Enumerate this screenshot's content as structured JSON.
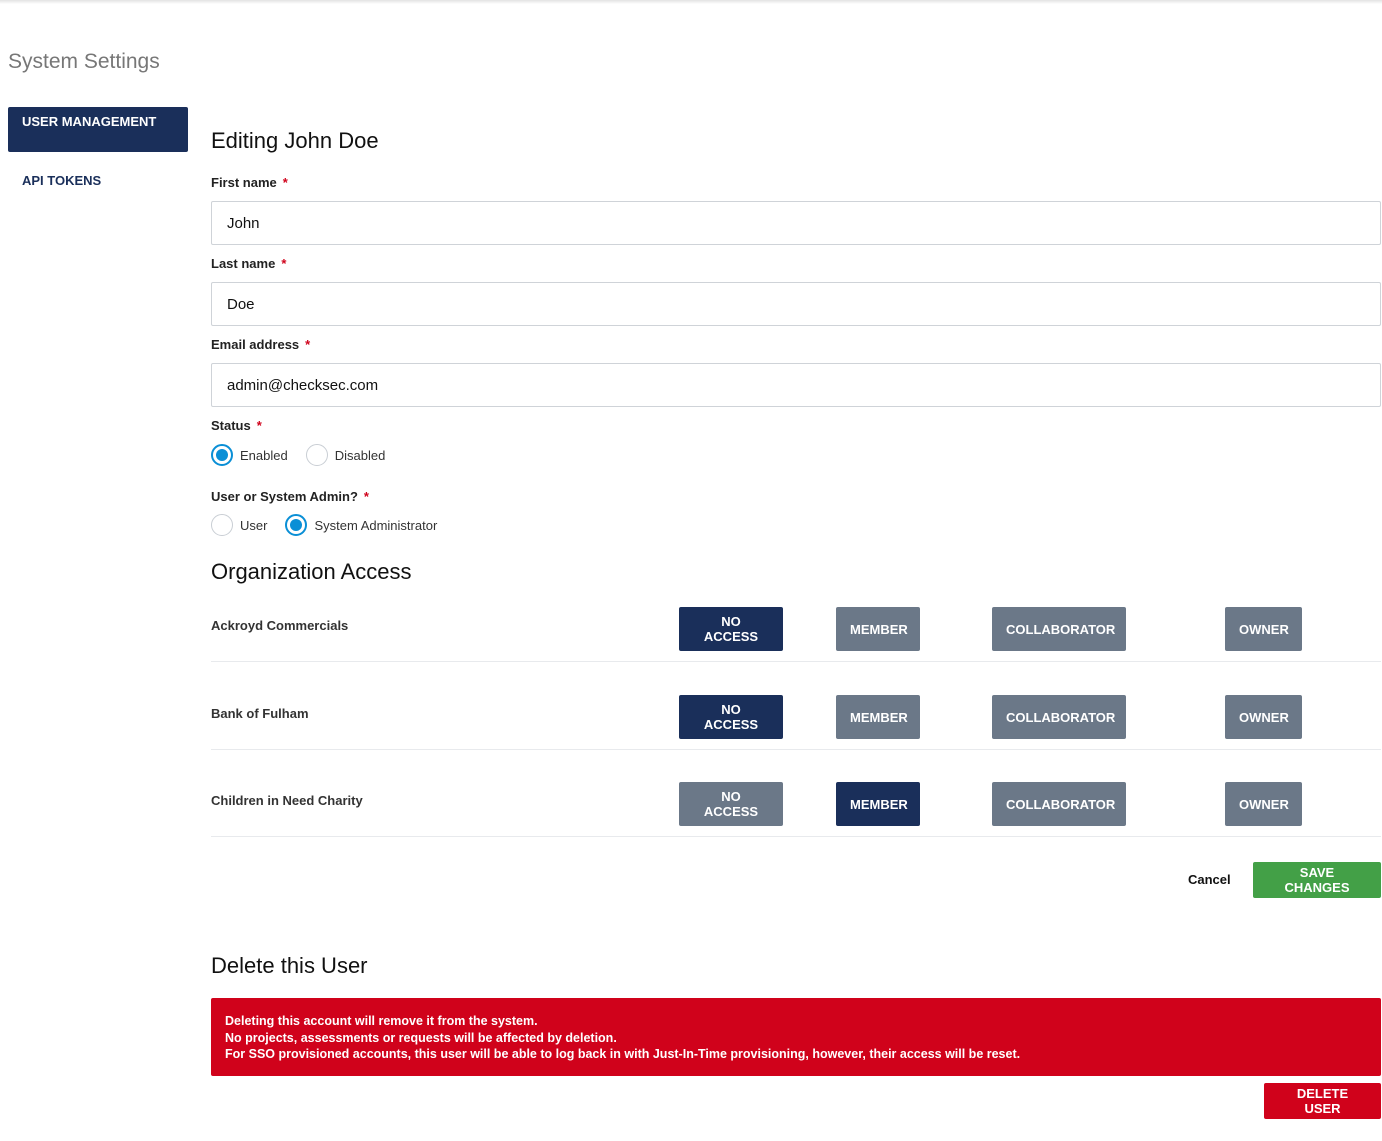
{
  "page": {
    "title": "System Settings"
  },
  "sidebar": {
    "items": [
      {
        "label": "USER MANAGEMENT",
        "active": true
      },
      {
        "label": "API TOKENS",
        "active": false
      }
    ]
  },
  "form": {
    "heading": "Editing John Doe",
    "first_name": {
      "label": "First name",
      "value": "John",
      "required": "*"
    },
    "last_name": {
      "label": "Last name",
      "value": "Doe",
      "required": "*"
    },
    "email": {
      "label": "Email address",
      "value": "admin@checksec.com",
      "required": "*"
    },
    "status": {
      "label": "Status",
      "required": "*",
      "options": [
        {
          "label": "Enabled",
          "checked": true
        },
        {
          "label": "Disabled",
          "checked": false
        }
      ]
    },
    "role": {
      "label": "User or System Admin?",
      "required": "*",
      "options": [
        {
          "label": "User",
          "checked": false
        },
        {
          "label": "System Administrator",
          "checked": true
        }
      ]
    }
  },
  "org_access": {
    "heading": "Organization Access",
    "levels": [
      "NO ACCESS",
      "MEMBER",
      "COLLABORATOR",
      "OWNER"
    ],
    "orgs": [
      {
        "name": "Ackroyd Commercials",
        "selected": "NO ACCESS"
      },
      {
        "name": "Bank of Fulham",
        "selected": "NO ACCESS"
      },
      {
        "name": "Children in Need Charity",
        "selected": "MEMBER"
      }
    ]
  },
  "actions": {
    "cancel": "Cancel",
    "save": "SAVE CHANGES"
  },
  "delete": {
    "heading": "Delete this User",
    "warning_lines": [
      "Deleting this account will remove it from the system.",
      "No projects, assessments or requests will be affected by deletion.",
      "For SSO provisioned accounts, this user will be able to log back in with Just-In-Time provisioning, however, their access will be reset."
    ],
    "button": "DELETE USER"
  },
  "colors": {
    "primary": "#1a2f5a",
    "inactive": "#6b7888",
    "success": "#43a047",
    "danger": "#d0021b",
    "radio": "#0a8fd6"
  }
}
